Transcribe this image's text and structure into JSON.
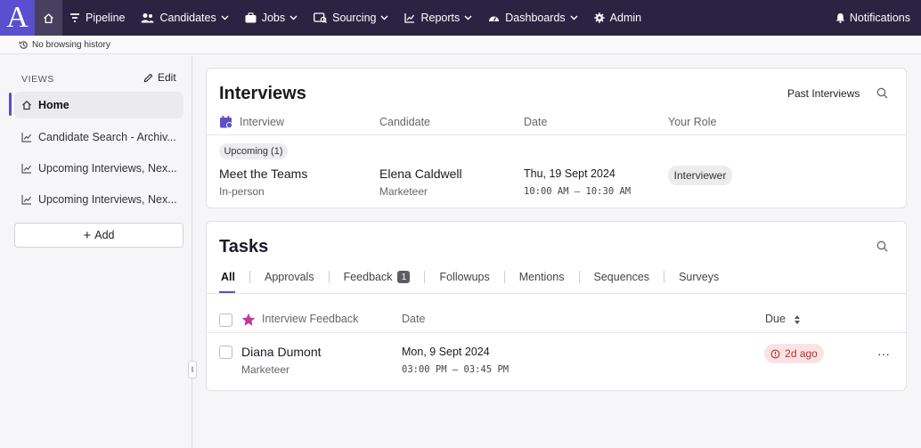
{
  "nav": {
    "logo_letter": "A",
    "items": [
      {
        "label": "Pipeline",
        "icon": "filter-icon",
        "dropdown": false
      },
      {
        "label": "Candidates",
        "icon": "people-icon",
        "dropdown": true
      },
      {
        "label": "Jobs",
        "icon": "briefcase-icon",
        "dropdown": true
      },
      {
        "label": "Sourcing",
        "icon": "sourcing-icon",
        "dropdown": true
      },
      {
        "label": "Reports",
        "icon": "chart-icon",
        "dropdown": true
      },
      {
        "label": "Dashboards",
        "icon": "gauge-icon",
        "dropdown": true
      },
      {
        "label": "Admin",
        "icon": "gear-icon",
        "dropdown": false
      }
    ],
    "notifications_label": "Notifications"
  },
  "history": {
    "label": "No browsing history"
  },
  "sidebar": {
    "views_label": "VIEWS",
    "edit_label": "Edit",
    "items": [
      {
        "label": "Home",
        "icon": "home-icon",
        "active": true
      },
      {
        "label": "Candidate Search - Archiv...",
        "icon": "chart-icon",
        "active": false
      },
      {
        "label": "Upcoming Interviews, Nex...",
        "icon": "chart-icon",
        "active": false
      },
      {
        "label": "Upcoming Interviews, Nex...",
        "icon": "chart-icon",
        "active": false
      }
    ],
    "add_label": "Add"
  },
  "interviews": {
    "title": "Interviews",
    "past_label": "Past Interviews",
    "columns": [
      "Interview",
      "Candidate",
      "Date",
      "Your Role"
    ],
    "group_label": "Upcoming (1)",
    "row": {
      "interview": "Meet the Teams",
      "interview_type": "In-person",
      "candidate": "Elena Caldwell",
      "candidate_role": "Marketeer",
      "date": "Thu, 19 Sept 2024",
      "time": "10:00 AM — 10:30 AM",
      "role": "Interviewer"
    }
  },
  "tasks": {
    "title": "Tasks",
    "tabs": [
      {
        "label": "All",
        "active": true
      },
      {
        "label": "Approvals",
        "active": false
      },
      {
        "label": "Feedback",
        "active": false,
        "badge": "1"
      },
      {
        "label": "Followups",
        "active": false
      },
      {
        "label": "Mentions",
        "active": false
      },
      {
        "label": "Sequences",
        "active": false
      },
      {
        "label": "Surveys",
        "active": false
      }
    ],
    "columns": {
      "task": "Interview Feedback",
      "date": "Date",
      "due": "Due"
    },
    "row": {
      "name": "Diana Dumont",
      "role": "Marketeer",
      "date": "Mon, 9 Sept 2024",
      "time": "03:00 PM — 03:45 PM",
      "due": "2d ago",
      "more": "···"
    }
  },
  "colors": {
    "nav_bg": "#2a2442",
    "accent": "#5a4fcf",
    "overdue_bg": "#fbe3e3",
    "overdue_text": "#b42e2e",
    "star": "#c0399a"
  }
}
